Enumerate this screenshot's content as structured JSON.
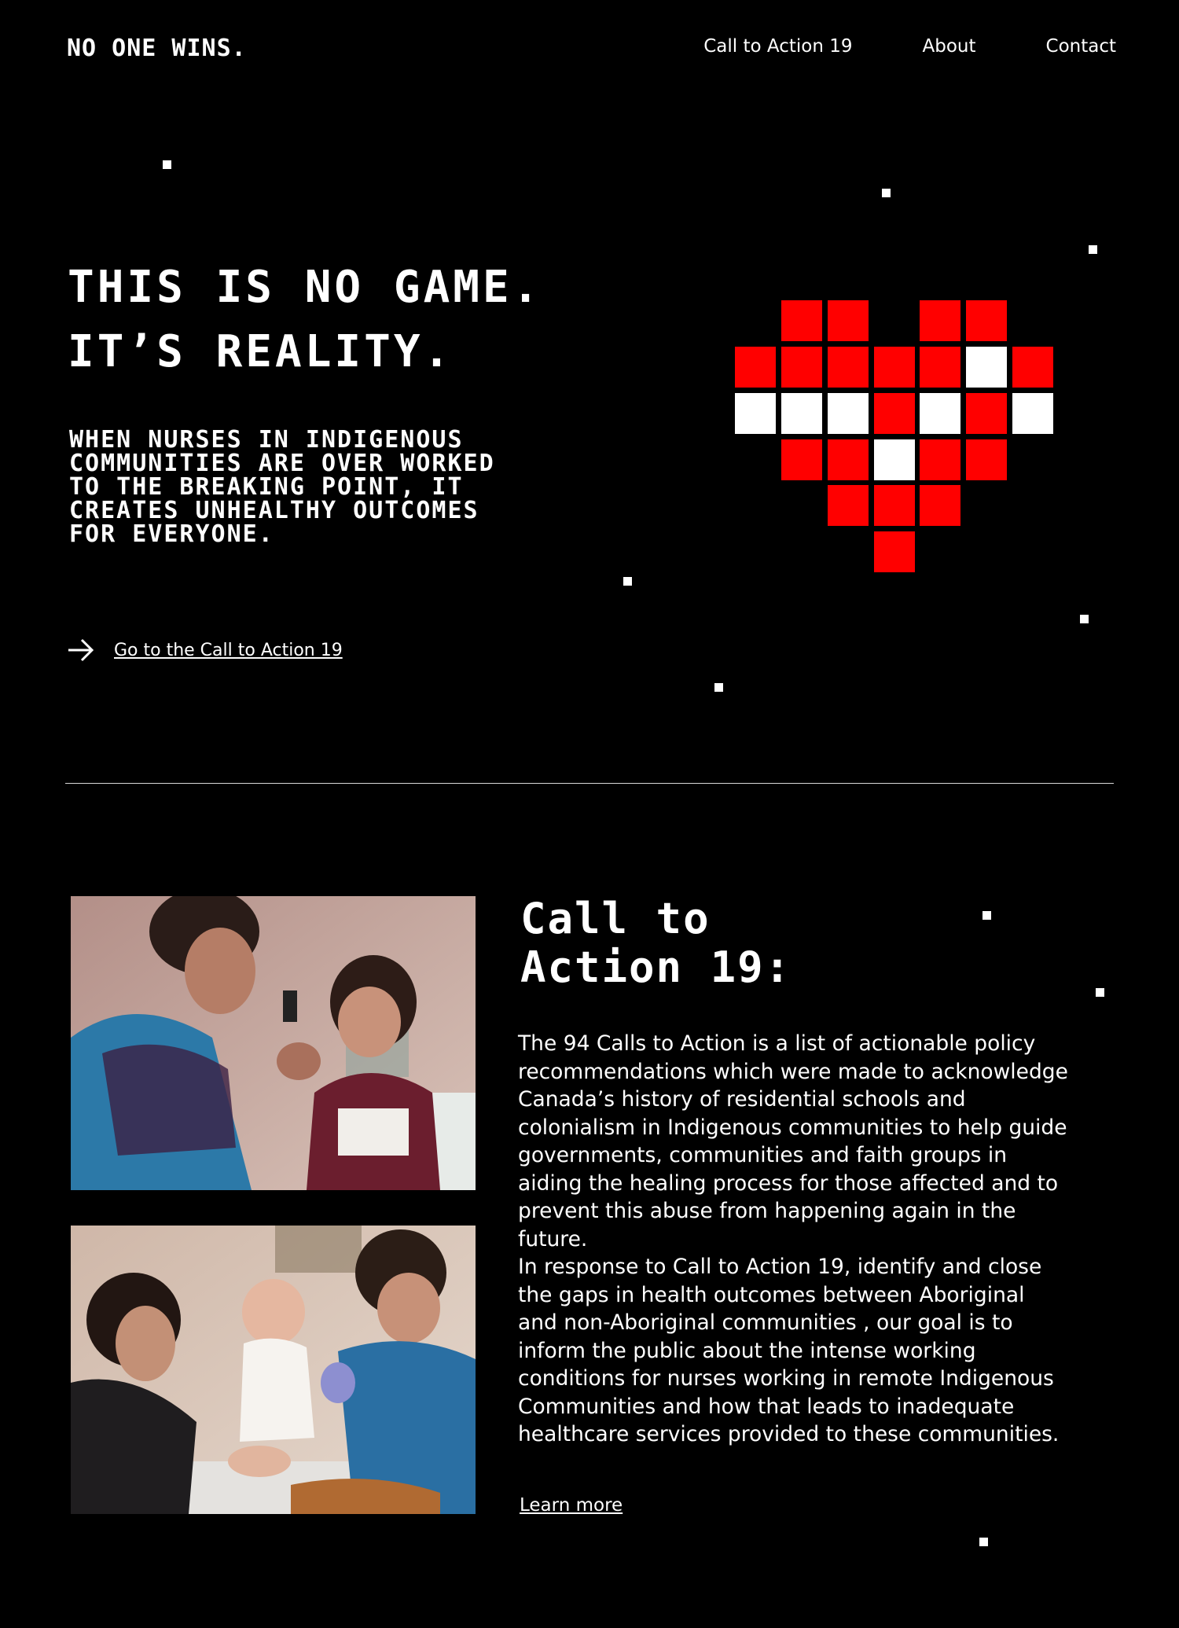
{
  "header": {
    "logo": "NO ONE WINS.",
    "nav": [
      "Call to Action 19",
      "About",
      "Contact"
    ]
  },
  "hero": {
    "title_line1": "THIS IS NO GAME.",
    "title_line2": "IT’S REALITY.",
    "subtitle": "WHEN NURSES IN INDIGENOUS COMMUNITIES ARE OVER WORKED TO THE BREAKING POINT, IT CREATES UNHEALTHY OUTCOMES FOR EVERYONE.",
    "cta_label": "Go to the Call to Action 19",
    "cta_icon": "arrow-right-icon",
    "heart_icon": "pixel-heart-icon"
  },
  "section": {
    "title_line1": "Call to",
    "title_line2": "Action 19:",
    "paragraph1": "The 94 Calls to Action is a list of actionable policy recommendations which were made to acknowledge Canada’s history of residential schools and colonialism in Indigenous communities to help guide governments, communities and faith groups in aiding the healing process for those affected and to prevent this abuse from happening again in the future.",
    "paragraph2": "In response to Call to Action 19, identify and close the gaps in health outcomes between Aboriginal and non-Aboriginal communities , our goal is to inform the public about the intense working conditions for nurses working in remote Indigenous Communities and how that leads to inadequate healthcare services provided to these communities.",
    "learn_more": "Learn more"
  },
  "colors": {
    "background": "#000000",
    "text": "#ffffff",
    "heart_red": "#ff0000",
    "heart_white": "#ffffff"
  }
}
